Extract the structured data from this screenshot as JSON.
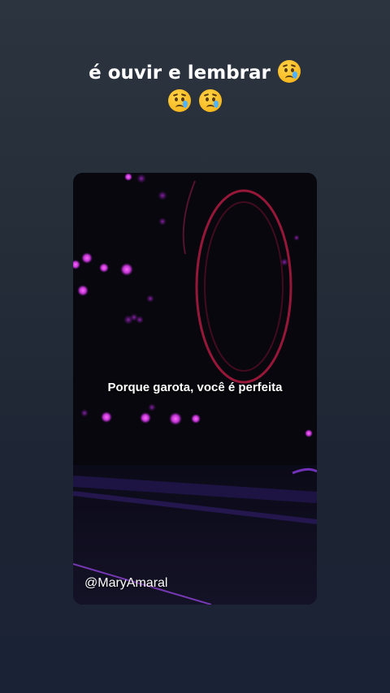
{
  "caption": {
    "line1_text": "é ouvir e lembrar",
    "line1_emoji_count": 1,
    "line2_emoji_count": 2,
    "emoji_name": "crying-face-icon"
  },
  "video": {
    "lyric": "Porque garota, você é perfeita",
    "handle": "@MaryAmaral"
  },
  "colors": {
    "background_top": "#2c3440",
    "background_bottom": "#1a2236",
    "lights": "#e040fb",
    "ring": "#d0204a",
    "text": "#ffffff"
  }
}
